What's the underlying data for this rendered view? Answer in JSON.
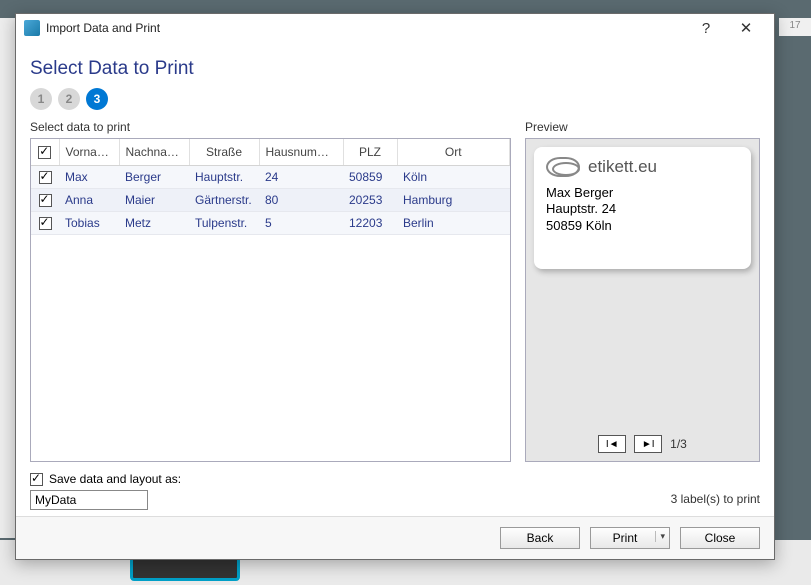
{
  "window": {
    "title": "Import Data and Print"
  },
  "wizard": {
    "heading": "Select Data to Print",
    "steps": [
      "1",
      "2",
      "3"
    ],
    "active_step": 3
  },
  "grid": {
    "label": "Select data to print",
    "columns": [
      "Vorname",
      "Nachname",
      "Straße",
      "Hausnummer",
      "PLZ",
      "Ort"
    ],
    "rows": [
      {
        "checked": true,
        "cells": [
          "Max",
          "Berger",
          "Hauptstr.",
          "24",
          "50859",
          "Köln"
        ]
      },
      {
        "checked": true,
        "cells": [
          "Anna",
          "Maier",
          "Gärtnerstr.",
          "80",
          "20253",
          "Hamburg"
        ]
      },
      {
        "checked": true,
        "cells": [
          "Tobias",
          "Metz",
          "Tulpenstr.",
          "5",
          "12203",
          "Berlin"
        ]
      }
    ]
  },
  "preview": {
    "label": "Preview",
    "logo_text": "etikett.eu",
    "line1": "Max Berger",
    "line2": "Hauptstr. 24",
    "line3": "50859 Köln",
    "page": "1/3"
  },
  "save": {
    "checked": true,
    "label": "Save data and layout as:",
    "value": "MyData"
  },
  "summary": "3 label(s) to print",
  "buttons": {
    "back": "Back",
    "print": "Print",
    "close": "Close"
  },
  "ruler_tick": "17"
}
